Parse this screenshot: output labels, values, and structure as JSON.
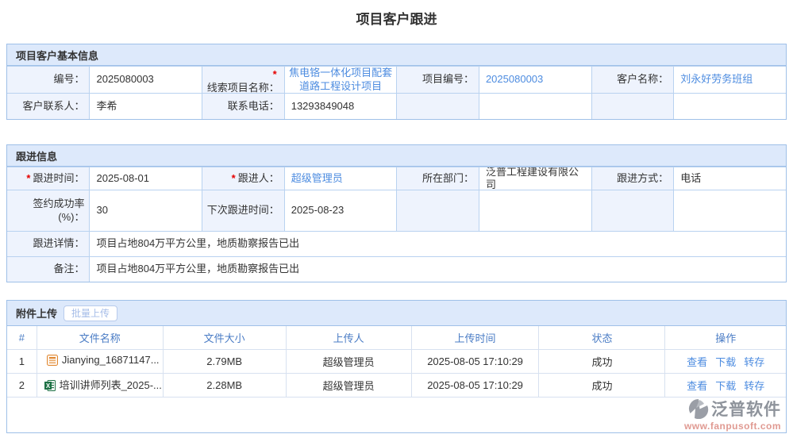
{
  "ui": {
    "required_mark": "*",
    "colors": {
      "link": "#4d8ce0",
      "section_header_bg": "#dde9fb",
      "panel_border": "#9fc0e8",
      "cell_border": "#b9d2f0",
      "table_border": "#d7e1f0",
      "label_bg": "#eef3fd",
      "required": "#e60000",
      "table_header_text": "#4a7cc5",
      "brand_gray": "#8e939b",
      "brand_url": "#e09a92"
    }
  },
  "page": {
    "title": "项目客户跟进"
  },
  "basic_info": {
    "header": "项目客户基本信息",
    "fields": {
      "number": {
        "label": "编号：",
        "value": "2025080003"
      },
      "lead_project": {
        "label": "线索项目名称：",
        "value": "焦电铬一体化项目配套道路工程设计项目"
      },
      "project_number": {
        "label": "项目编号：",
        "value": "2025080003"
      },
      "customer_name": {
        "label": "客户名称：",
        "value": "刘永好劳务班组"
      },
      "contact": {
        "label": "客户联系人：",
        "value": "李希"
      },
      "phone": {
        "label": "联系电话：",
        "value": "13293849048"
      }
    }
  },
  "follow_info": {
    "header": "跟进信息",
    "fields": {
      "follow_time": {
        "label": "跟进时间：",
        "value": "2025-08-01"
      },
      "follower": {
        "label": "跟进人：",
        "value": "超级管理员"
      },
      "department": {
        "label": "所在部门：",
        "value": "泛普工程建设有限公司"
      },
      "follow_method": {
        "label": "跟进方式：",
        "value": "电话"
      },
      "success_rate": {
        "label": "签约成功率(%)：",
        "value": "30"
      },
      "next_follow_time": {
        "label": "下次跟进时间：",
        "value": "2025-08-23"
      },
      "detail": {
        "label": "跟进详情：",
        "value": "项目占地804万平方公里，地质勘察报告已出"
      },
      "remark": {
        "label": "备注：",
        "value": "项目占地804万平方公里，地质勘察报告已出"
      }
    }
  },
  "attachments": {
    "header": "附件上传",
    "batch_upload": "批量上传",
    "columns": [
      "#",
      "文件名称",
      "文件大小",
      "上传人",
      "上传时间",
      "状态",
      "操作"
    ],
    "rows": [
      {
        "index": "1",
        "icon": "doc-file-icon",
        "name": "Jianying_16871147...",
        "size": "2.79MB",
        "uploader": "超级管理员",
        "time": "2025-08-05 17:10:29",
        "status": "成功",
        "actions": {
          "view": "查看",
          "download": "下载",
          "transfer": "转存"
        }
      },
      {
        "index": "2",
        "icon": "excel-file-icon",
        "name": "培训讲师列表_2025-...",
        "size": "2.28MB",
        "uploader": "超级管理员",
        "time": "2025-08-05 17:10:29",
        "status": "成功",
        "actions": {
          "view": "查看",
          "download": "下载",
          "transfer": "转存"
        }
      }
    ]
  },
  "watermark": {
    "brand": "泛普软件",
    "url": "www.fanpusoft.com"
  }
}
